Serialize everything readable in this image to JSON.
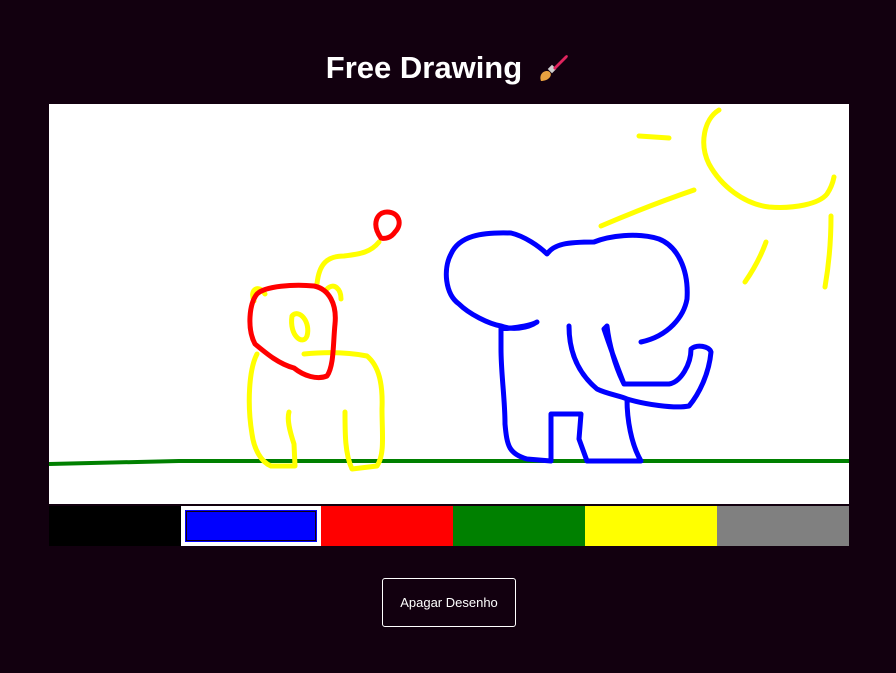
{
  "header": {
    "title": "Free Drawing"
  },
  "icons": {
    "title_icon": "paintbrush-icon"
  },
  "palette": {
    "colors": [
      "#000000",
      "#0000ff",
      "#ff0000",
      "#008000",
      "#ffff00",
      "#808080"
    ],
    "selected_index": 1
  },
  "actions": {
    "clear_label": "Apagar Desenho"
  }
}
